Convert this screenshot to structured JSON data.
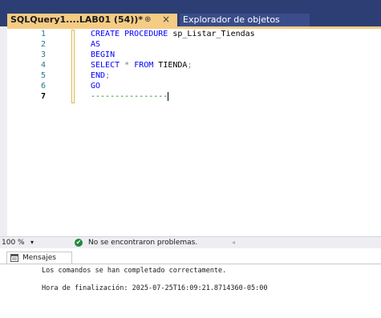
{
  "tabs": {
    "active": {
      "label": "SQLQuery1....LAB01 (54))*",
      "pin_glyph": "⊕",
      "close_glyph": "×"
    },
    "inactive": {
      "label": "Explorador de objetos"
    }
  },
  "editor": {
    "lines": [
      {
        "num": "1",
        "tokens": [
          {
            "t": "CREATE PROCEDURE",
            "c": "kw"
          },
          {
            "t": " sp_Listar_Tiendas",
            "c": "plain"
          }
        ]
      },
      {
        "num": "2",
        "tokens": [
          {
            "t": "AS",
            "c": "kw"
          }
        ]
      },
      {
        "num": "3",
        "tokens": [
          {
            "t": "BEGIN",
            "c": "kw"
          }
        ]
      },
      {
        "num": "4",
        "tokens": [
          {
            "t": "SELECT",
            "c": "kw"
          },
          {
            "t": " * ",
            "c": "op"
          },
          {
            "t": "FROM",
            "c": "kw"
          },
          {
            "t": " TIENDA",
            "c": "plain"
          },
          {
            "t": ";",
            "c": "op"
          }
        ]
      },
      {
        "num": "5",
        "tokens": [
          {
            "t": "END",
            "c": "kw"
          },
          {
            "t": ";",
            "c": "op"
          }
        ]
      },
      {
        "num": "6",
        "tokens": [
          {
            "t": "GO",
            "c": "kw"
          }
        ]
      },
      {
        "num": "7",
        "current": true,
        "tokens": [
          {
            "t": "----------------",
            "c": "cmt"
          }
        ]
      }
    ]
  },
  "statusbar": {
    "zoom": "100 %",
    "zoom_caret": "▾",
    "check_glyph": "✔",
    "status_text": "No se encontraron problemas.",
    "scroll_left": "◂"
  },
  "results": {
    "tab_label": "Mensajes",
    "messages": [
      "Los comandos se han completado correctamente.",
      "Hora de finalización: 2025-07-25T16:09:21.8714360-05:00"
    ]
  },
  "colors": {
    "keyword": "#0000ff",
    "comment": "#008000",
    "line_number": "#237893",
    "tab_active": "#f5cc84",
    "title_bar": "#2c3e74"
  }
}
